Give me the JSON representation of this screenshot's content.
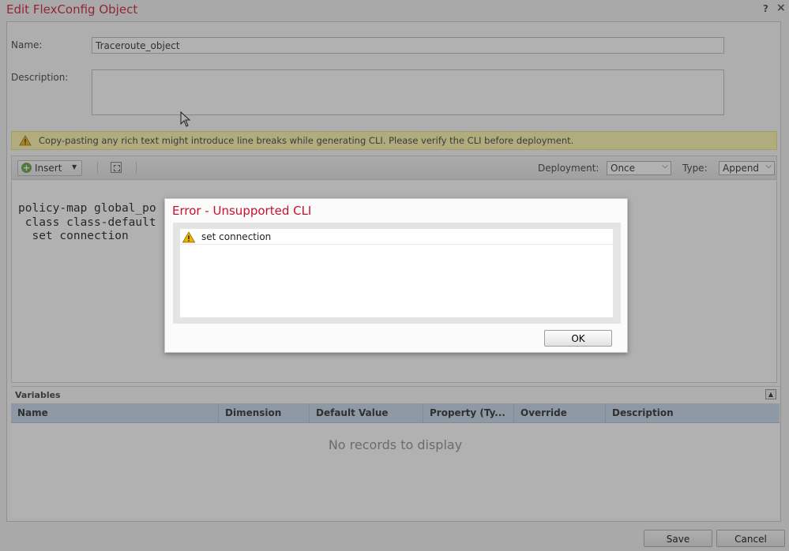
{
  "window": {
    "title": "Edit FlexConfig Object",
    "help_glyph": "?",
    "close_glyph": "×"
  },
  "form": {
    "name_label": "Name:",
    "name_value": "Traceroute_object",
    "description_label": "Description:",
    "description_value": ""
  },
  "warning_banner": {
    "icon": "warning-icon",
    "text": "Copy-pasting any rich text might introduce line breaks while generating CLI. Please verify the CLI before deployment."
  },
  "toolbar": {
    "insert_label": "Insert",
    "insert_caret": "▼",
    "deployment_label": "Deployment:",
    "deployment_value": "Once",
    "type_label": "Type:",
    "type_value": "Append",
    "chevron": "⌵"
  },
  "editor": {
    "cli_text": "policy-map global_po\n class class-default\n  set connection"
  },
  "variables": {
    "title": "Variables",
    "collapse_glyph": "▲",
    "columns": [
      "Name",
      "Dimension",
      "Default Value",
      "Property (Ty...",
      "Override",
      "Description"
    ],
    "empty_text": "No records to display"
  },
  "footer": {
    "save_label": "Save",
    "cancel_label": "Cancel"
  },
  "modal": {
    "title": "Error - Unsupported CLI",
    "items": [
      {
        "icon": "warning-icon",
        "text": "set connection"
      }
    ],
    "ok_label": "OK"
  },
  "colors": {
    "title_red": "#c8102e",
    "banner_yellow": "#fff7a6",
    "grid_header_blue": "#c3d6ea",
    "overlay": "rgba(70,70,70,0.42)"
  }
}
